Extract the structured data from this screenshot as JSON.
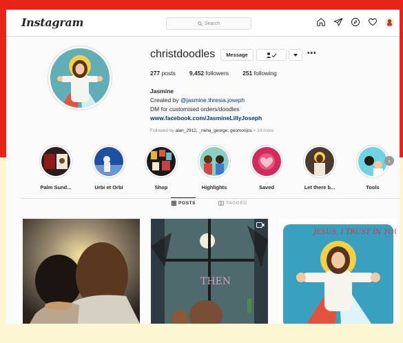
{
  "topbar": {
    "logo": "Instagram",
    "search_placeholder": "Search",
    "icons": [
      "home-icon",
      "direct-icon",
      "explore-icon",
      "heart-icon",
      "avatar"
    ]
  },
  "profile": {
    "username": "christdoodles",
    "message_label": "Message",
    "stats": {
      "posts_count": "277",
      "posts_label": "posts",
      "followers_count": "9,452",
      "followers_label": "followers",
      "following_count": "251",
      "following_label": "following"
    },
    "bio": {
      "name": "Jasmine",
      "created_prefix": "Created by ",
      "created_mention": "@jasmine.thresia.joseph",
      "line2": "DM for customised orders/doodles",
      "link": "www.facebook.com/JasmineLillyJoseph"
    },
    "followed_by": {
      "prefix": "Followed by ",
      "names": "alan_2912, _neha_george, geomonjos",
      "more": " + 14 more"
    }
  },
  "highlights": [
    {
      "label": "Palm Sund..."
    },
    {
      "label": "Urbi et Orbi"
    },
    {
      "label": "Shop"
    },
    {
      "label": "Highlights"
    },
    {
      "label": "Saved"
    },
    {
      "label": "Let there b..."
    },
    {
      "label": "Tools"
    }
  ],
  "tabs": {
    "posts": "POSTS",
    "tagged": "TAGGED"
  },
  "posts": [
    {
      "caption": ""
    },
    {
      "caption": "THEN"
    },
    {
      "caption": "JESUS, I TRUST IN YOU!"
    }
  ]
}
